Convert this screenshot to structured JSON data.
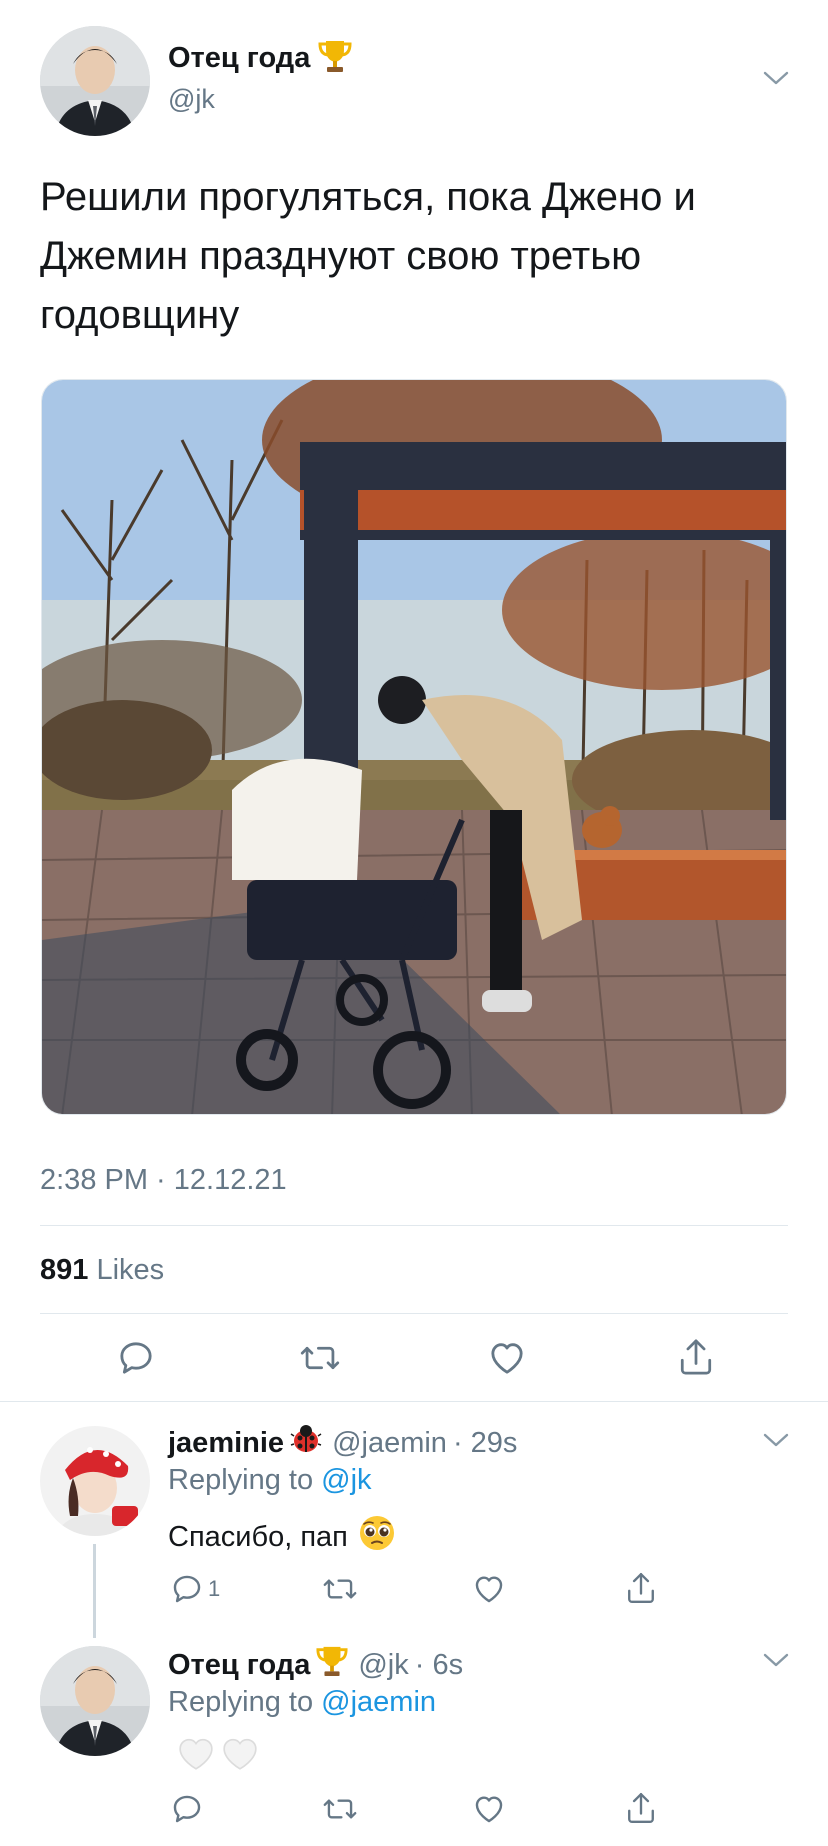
{
  "tweet": {
    "author_name": "Отец года",
    "author_handle": "@jk",
    "text_line1": "Решили прогуляться, пока Джено и",
    "text_line2": "Джемин празднуют свою третью",
    "text_line3": "годовщину",
    "timestamp": "2:38 PM · 12.12.21",
    "likes_count": "891",
    "likes_label": "Likes"
  },
  "replies": [
    {
      "author_name": "jaeminie",
      "author_handle": "@jaemin",
      "time": "· 29s",
      "replying_prefix": "Replying to",
      "replying_to": "@jk",
      "text": "Спасибо, пап",
      "reply_count": "1"
    },
    {
      "author_name": "Отец года",
      "author_handle": "@jk",
      "time": "· 6s",
      "replying_prefix": "Replying to",
      "replying_to": "@jaemin",
      "text": "🤍🤍",
      "reply_count": ""
    }
  ],
  "icons": {
    "reply": "reply-icon",
    "retweet": "retweet-icon",
    "like": "heart-icon",
    "share": "share-icon",
    "more": "chevron-down-icon",
    "trophy": "trophy-icon",
    "ladybug": "ladybug-icon",
    "pleading": "pleading-face-icon"
  },
  "colors": {
    "text": "#14171a",
    "muted": "#657786",
    "link": "#1b95e0",
    "divider": "#e1e8ed"
  }
}
